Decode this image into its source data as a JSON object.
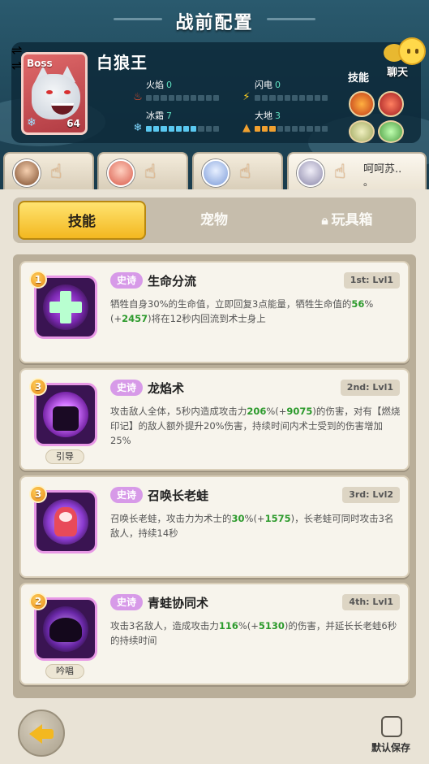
{
  "header": {
    "title": "战前配置",
    "chat_label": "聊天"
  },
  "boss": {
    "tag": "Boss",
    "name": "白狼王",
    "level": "64",
    "stats": [
      {
        "name": "火焰",
        "value": "0",
        "filled": 0,
        "type": "fire"
      },
      {
        "name": "闪电",
        "value": "0",
        "filled": 0,
        "type": "lightning"
      },
      {
        "name": "冰霜",
        "value": "7",
        "filled": 7,
        "type": "ice"
      },
      {
        "name": "大地",
        "value": "3",
        "filled": 3,
        "type": "earth"
      }
    ],
    "skills_label": "技能",
    "skill_icons": [
      "fire-skill-icon",
      "claw-skill-icon",
      "wind-skill-icon",
      "nature-skill-icon"
    ]
  },
  "team": {
    "active_speech": "呵呵苏..",
    "active_speech_tail": "。",
    "slots": [
      {
        "hero": "hero-1",
        "status": "green"
      },
      {
        "hero": "hero-2",
        "status": "red"
      },
      {
        "hero": "hero-3",
        "status": "blue"
      },
      {
        "hero": "hero-4",
        "status": "purple"
      }
    ]
  },
  "tabs": [
    {
      "label": "技能",
      "active": true,
      "locked": false
    },
    {
      "label": "宠物",
      "active": false,
      "locked": false
    },
    {
      "label": "玩具箱",
      "active": false,
      "locked": true
    }
  ],
  "skills": [
    {
      "rank": "1",
      "rarity": "史诗",
      "name": "生命分流",
      "slot": "1st: Lvl1",
      "tag": "",
      "icon": "heal-cross-icon",
      "desc_parts": [
        {
          "t": "牺牲自身30%的生命值，立即回复3点能量，牺牲生命值的",
          "g": false
        },
        {
          "t": "56",
          "g": true
        },
        {
          "t": "%(+",
          "g": false
        },
        {
          "t": "2457",
          "g": true
        },
        {
          "t": ")将在12秒内回流到术士身上",
          "g": false
        }
      ]
    },
    {
      "rank": "3",
      "rarity": "史诗",
      "name": "龙焰术",
      "slot": "2nd: Lvl1",
      "tag": "引导",
      "icon": "dark-flame-icon",
      "desc_parts": [
        {
          "t": "攻击敌人全体，5秒内造成攻击力",
          "g": false
        },
        {
          "t": "206",
          "g": true
        },
        {
          "t": "%(+",
          "g": false
        },
        {
          "t": "9075",
          "g": true
        },
        {
          "t": ")的伤害，对有【燃烧印记】的敌人额外提升20%伤害，持续时间内术士受到的伤害增加25%",
          "g": false
        }
      ]
    },
    {
      "rank": "3",
      "rarity": "史诗",
      "name": "召唤长老蛙",
      "slot": "3rd: Lvl2",
      "tag": "",
      "icon": "elder-frog-icon",
      "desc_parts": [
        {
          "t": "召唤长老蛙，攻击力为术士的",
          "g": false
        },
        {
          "t": "30",
          "g": true
        },
        {
          "t": "%(+",
          "g": false
        },
        {
          "t": "1575",
          "g": true
        },
        {
          "t": ")，长老蛙可同时攻击3名敌人，持续14秒",
          "g": false
        }
      ]
    },
    {
      "rank": "2",
      "rarity": "史诗",
      "name": "青蛙协同术",
      "slot": "4th: Lvl1",
      "tag": "吟唱",
      "icon": "shadow-frog-icon",
      "desc_parts": [
        {
          "t": "攻击3名敌人，造成攻击力",
          "g": false
        },
        {
          "t": "116",
          "g": true
        },
        {
          "t": "%(+",
          "g": false
        },
        {
          "t": "5130",
          "g": true
        },
        {
          "t": ")的伤害，并延长长老蛙6秒的持续时间",
          "g": false
        }
      ]
    }
  ],
  "footer": {
    "save_label": "默认保存",
    "save_checked": false
  }
}
